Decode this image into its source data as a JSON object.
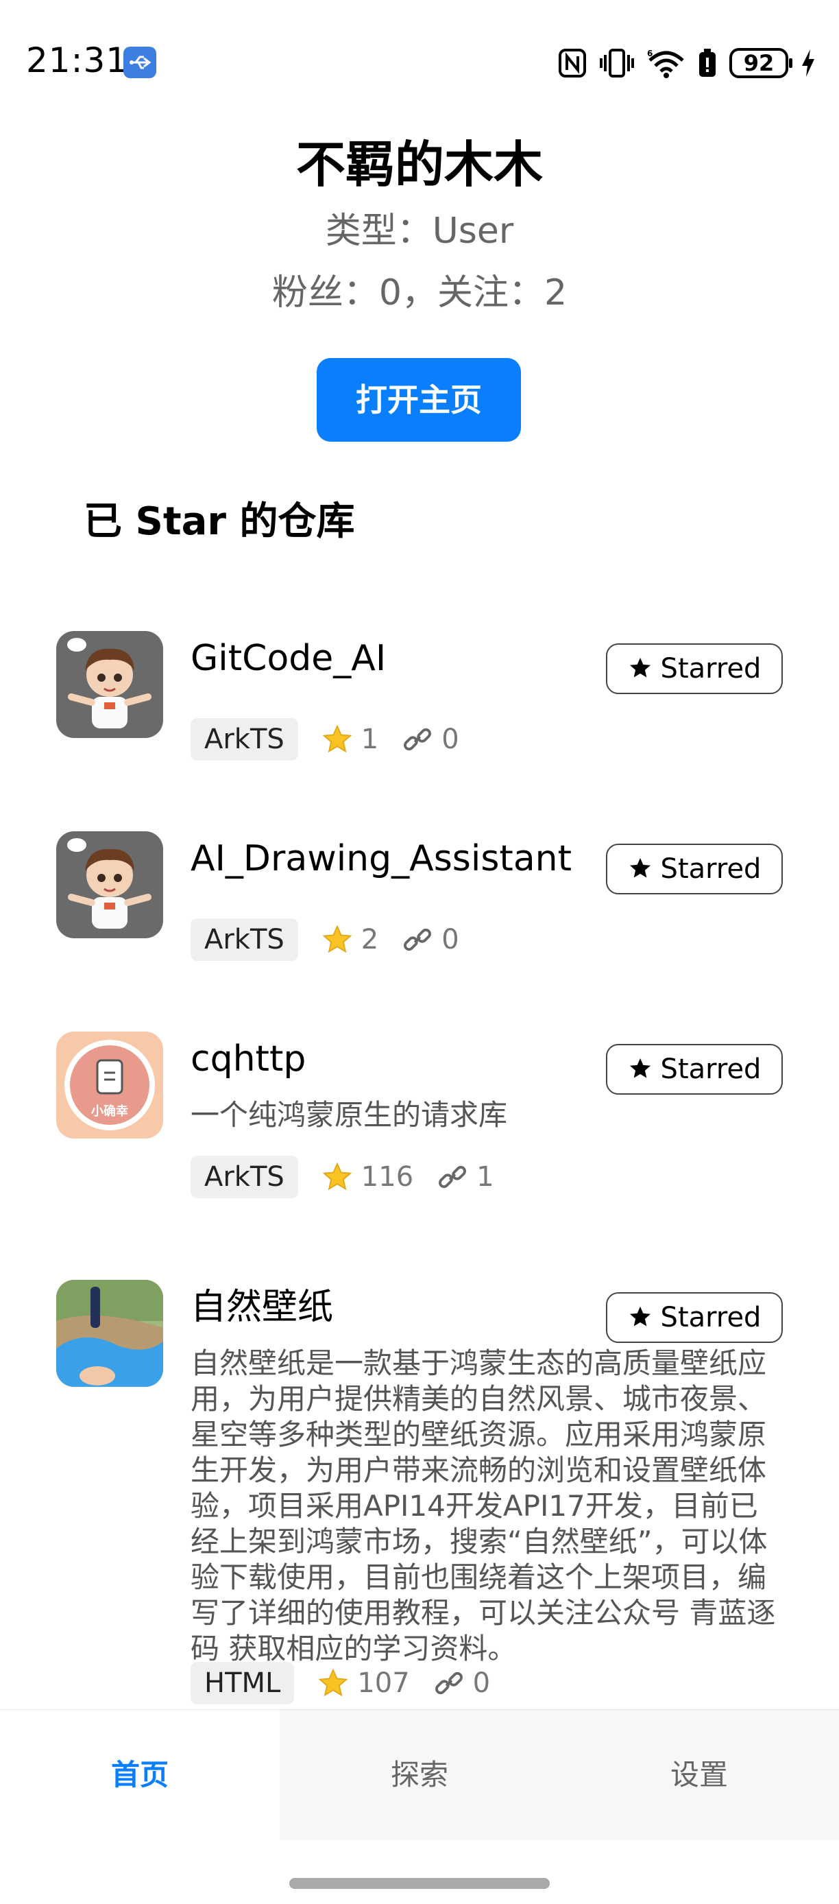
{
  "status_bar": {
    "time": "21:31",
    "battery": "92",
    "icons": [
      "usb-icon",
      "nfc-icon",
      "vibrate-icon",
      "wifi-icon",
      "battery-saver-icon",
      "battery-icon",
      "charging-icon"
    ]
  },
  "profile": {
    "name": "不羁的木木",
    "type_line": "类型：User",
    "stats_line": "粉丝：0，关注：2",
    "open_button": "打开主页"
  },
  "section_title": "已 Star 的仓库",
  "repos": [
    {
      "name": "GitCode_AI",
      "desc": "",
      "star_label": "Starred",
      "language": "ArkTS",
      "stars": "1",
      "forks": "0",
      "avatar": "cartoon-boy"
    },
    {
      "name": "AI_Drawing_Assistant",
      "desc": "",
      "star_label": "Starred",
      "language": "ArkTS",
      "stars": "2",
      "forks": "0",
      "avatar": "cartoon-boy"
    },
    {
      "name": "cqhttp",
      "desc": "一个纯鸿蒙原生的请求库",
      "star_label": "Starred",
      "language": "ArkTS",
      "stars": "116",
      "forks": "1",
      "avatar": "小确幸"
    },
    {
      "name": "自然壁纸",
      "desc": "自然壁纸是一款基于鸿蒙生态的高质量壁纸应用，为用户提供精美的自然风景、城市夜景、星空等多种类型的壁纸资源。应用采用鸿蒙原生开发，为用户带来流畅的浏览和设置壁纸体验，项目采用API14开发API17开发，目前已经上架到鸿蒙市场，搜索“自然壁纸”，可以体验下载使用，目前也围绕着这个上架项目，编写了详细的使用教程，可以关注公众号 青蓝逐码 获取相应的学习资料。",
      "star_label": "Starred",
      "language": "HTML",
      "stars": "107",
      "forks": "0",
      "avatar": "photo"
    }
  ],
  "tabs": [
    {
      "label": "首页",
      "active": true
    },
    {
      "label": "探索",
      "active": false
    },
    {
      "label": "设置",
      "active": false
    }
  ],
  "colors": {
    "accent": "#0A7FFE",
    "secondary_text": "#666666",
    "tab_bar_bg": "#F7F7F7"
  }
}
